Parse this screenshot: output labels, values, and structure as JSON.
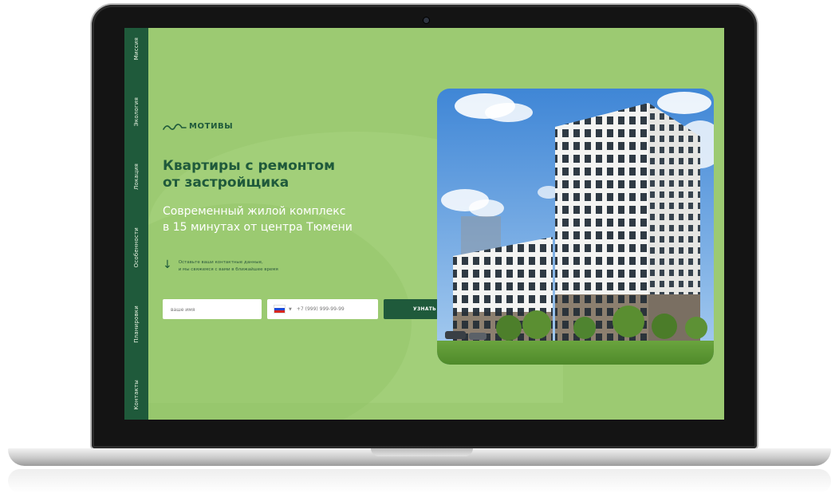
{
  "nav": {
    "items": [
      {
        "label": "Миссия"
      },
      {
        "label": "Экология"
      },
      {
        "label": "Локация"
      },
      {
        "label": "Особенности"
      },
      {
        "label": "Планировки"
      },
      {
        "label": "Контакты"
      }
    ]
  },
  "brand": {
    "name": "МОТИВЫ",
    "color": "#1f5a3b"
  },
  "hero": {
    "headline_line1": "Квартиры с ремонтом",
    "headline_line2": "от застройщика",
    "sub_line1": "Современный жилой комплекс",
    "sub_line2": "в 15 минутах от центра Тюмени"
  },
  "form": {
    "hint_line1": "Оставьте ваши контактные данные,",
    "hint_line2": "и мы свяжемся с вами в ближайшее время",
    "name_placeholder": "ваше имя",
    "phone_placeholder": "+7 (999) 999-99-99",
    "submit_label": "УЗНАТЬ БОЛЬШЕ"
  },
  "colors": {
    "background": "#9cca72",
    "accent": "#1f5a3b",
    "text_light": "#ffffff"
  }
}
